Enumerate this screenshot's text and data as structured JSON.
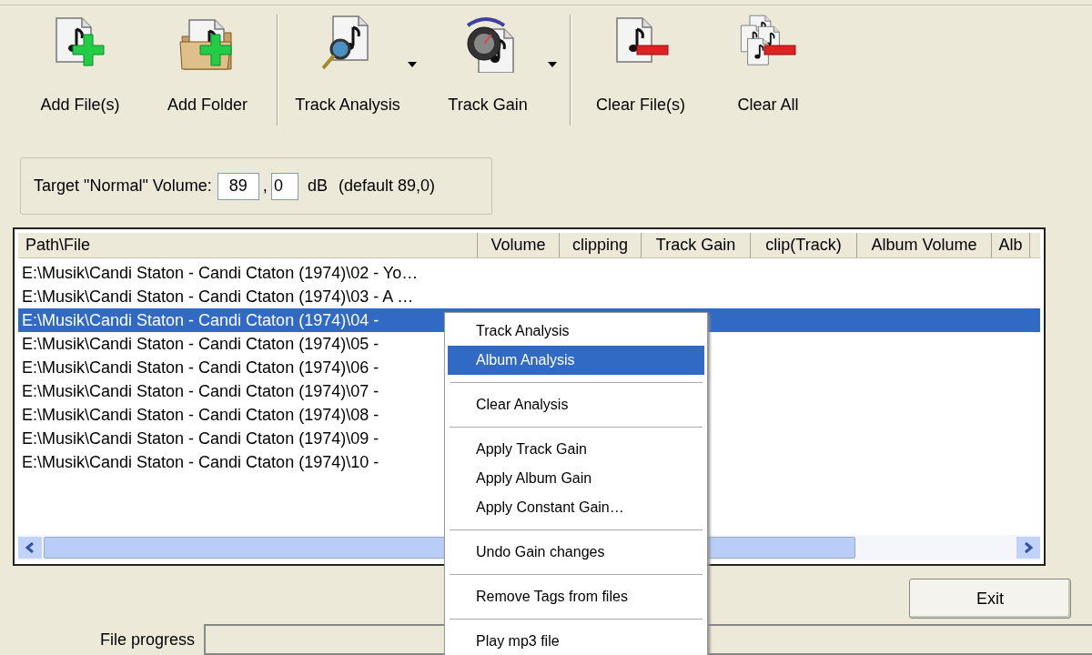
{
  "toolbar": [
    {
      "label": "Add File(s)",
      "kind": "add-file",
      "dropdown": false
    },
    {
      "label": "Add Folder",
      "kind": "add-folder",
      "dropdown": false
    },
    {
      "label": "Track Analysis",
      "kind": "analysis",
      "dropdown": true
    },
    {
      "label": "Track Gain",
      "kind": "gain",
      "dropdown": true
    },
    {
      "label": "Clear File(s)",
      "kind": "clear-file",
      "dropdown": false
    },
    {
      "label": "Clear All",
      "kind": "clear-all",
      "dropdown": false
    }
  ],
  "target": {
    "label": "Target \"Normal\" Volume:",
    "integer": "89",
    "comma": ",",
    "decimal": "0",
    "unit": "dB",
    "default": "(default 89,0)"
  },
  "table": {
    "columns": [
      "Path\\File",
      "Volume",
      "clipping",
      "Track Gain",
      "clip(Track)",
      "Album Volume",
      "Alb"
    ],
    "rows": [
      {
        "path": "E:\\Musik\\Candi Staton - Candi Ctaton (1974)\\02 - Yo…",
        "selected": false
      },
      {
        "path": "E:\\Musik\\Candi Staton - Candi Ctaton (1974)\\03 - A …",
        "selected": false
      },
      {
        "path": "E:\\Musik\\Candi Staton - Candi Ctaton (1974)\\04 -",
        "selected": true
      },
      {
        "path": "E:\\Musik\\Candi Staton - Candi Ctaton (1974)\\05 -",
        "selected": false
      },
      {
        "path": "E:\\Musik\\Candi Staton - Candi Ctaton (1974)\\06 -",
        "selected": false
      },
      {
        "path": "E:\\Musik\\Candi Staton - Candi Ctaton (1974)\\07 -",
        "selected": false
      },
      {
        "path": "E:\\Musik\\Candi Staton - Candi Ctaton (1974)\\08 -",
        "selected": false
      },
      {
        "path": "E:\\Musik\\Candi Staton - Candi Ctaton (1974)\\09 -",
        "selected": false
      },
      {
        "path": "E:\\Musik\\Candi Staton - Candi Ctaton (1974)\\10 -",
        "selected": false
      }
    ]
  },
  "exit_button": {
    "label": "Exit"
  },
  "progress": {
    "label": "File progress",
    "level": 0
  },
  "context_menu": [
    {
      "kind": "item",
      "label": "Track Analysis",
      "selected": false
    },
    {
      "kind": "item",
      "label": "Album Analysis",
      "selected": true
    },
    {
      "kind": "separator"
    },
    {
      "kind": "item",
      "label": "Clear Analysis",
      "selected": false
    },
    {
      "kind": "separator"
    },
    {
      "kind": "item",
      "label": "Apply Track Gain",
      "selected": false
    },
    {
      "kind": "item",
      "label": "Apply Album Gain",
      "selected": false
    },
    {
      "kind": "item",
      "label": "Apply Constant Gain…",
      "selected": false
    },
    {
      "kind": "separator"
    },
    {
      "kind": "item",
      "label": "Undo Gain changes",
      "selected": false
    },
    {
      "kind": "separator"
    },
    {
      "kind": "item",
      "label": "Remove Tags from files",
      "selected": false
    },
    {
      "kind": "separator"
    },
    {
      "kind": "item",
      "label": "Play mp3 file",
      "selected": false
    }
  ]
}
